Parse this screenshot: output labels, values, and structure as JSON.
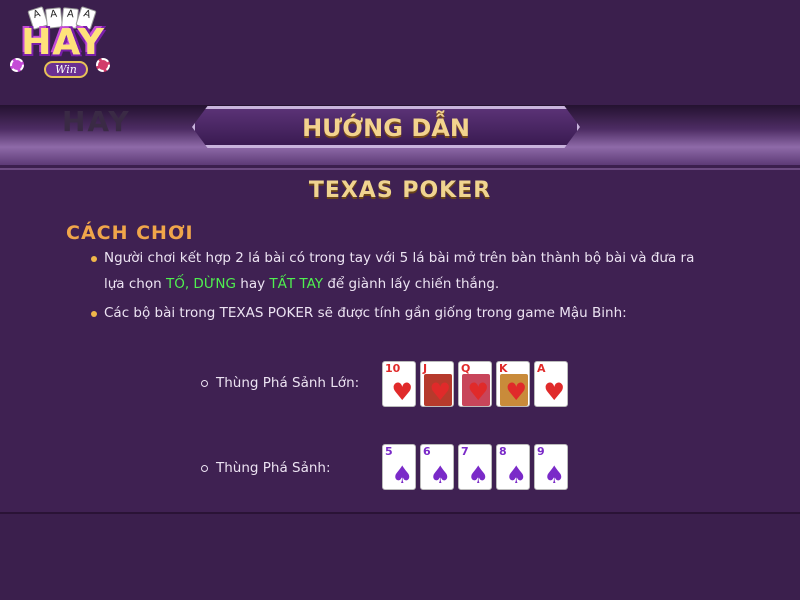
{
  "logo": {
    "word": "HAY",
    "badge": "Win",
    "mini_cards": [
      "A",
      "A",
      "A",
      "A"
    ]
  },
  "header": {
    "title": "HƯỚNG DẪN",
    "ghost_text": "HAY"
  },
  "content": {
    "game_title": "TEXAS POKER",
    "section_title": "CÁCH CHƠI",
    "para1_line1": "Người chơi kết hợp 2 lá bài có trong tay với 5 lá bài mở trên bàn thành bộ bài và đưa ra",
    "para1_line2_a": "lựa chọn ",
    "para1_hl1": "TỐ, DỪNG",
    "para1_line2_b": " hay ",
    "para1_hl2": "TẤT TAY",
    "para1_line2_c": " để giành lấy chiến thắng.",
    "para2": "Các bộ bài trong TEXAS POKER  sẽ được tính gần giống trong game Mậu Binh:",
    "hands": [
      {
        "label": "Thùng Phá Sảnh Lớn:",
        "cards": [
          {
            "rank": "10",
            "suit": "♥",
            "color": "#e02a2a",
            "art": ""
          },
          {
            "rank": "J",
            "suit": "♥",
            "color": "#e02a2a",
            "art": "#b63a2c"
          },
          {
            "rank": "Q",
            "suit": "♥",
            "color": "#e02a2a",
            "art": "#c8455a"
          },
          {
            "rank": "K",
            "suit": "♥",
            "color": "#e02a2a",
            "art": "#c98b3a"
          },
          {
            "rank": "A",
            "suit": "♥",
            "color": "#e02a2a",
            "art": ""
          }
        ]
      },
      {
        "label": "Thùng Phá Sảnh:",
        "cards": [
          {
            "rank": "5",
            "suit": "♠",
            "color": "#7a2ac8",
            "art": ""
          },
          {
            "rank": "6",
            "suit": "♠",
            "color": "#7a2ac8",
            "art": ""
          },
          {
            "rank": "7",
            "suit": "♠",
            "color": "#7a2ac8",
            "art": ""
          },
          {
            "rank": "8",
            "suit": "♠",
            "color": "#7a2ac8",
            "art": ""
          },
          {
            "rank": "9",
            "suit": "♠",
            "color": "#7a2ac8",
            "art": ""
          }
        ]
      }
    ]
  },
  "colors": {
    "background": "#3b1f4d",
    "accent_gold": "#f0d490",
    "section_orange": "#f0a64a",
    "highlight_green": "#4ff04f"
  }
}
